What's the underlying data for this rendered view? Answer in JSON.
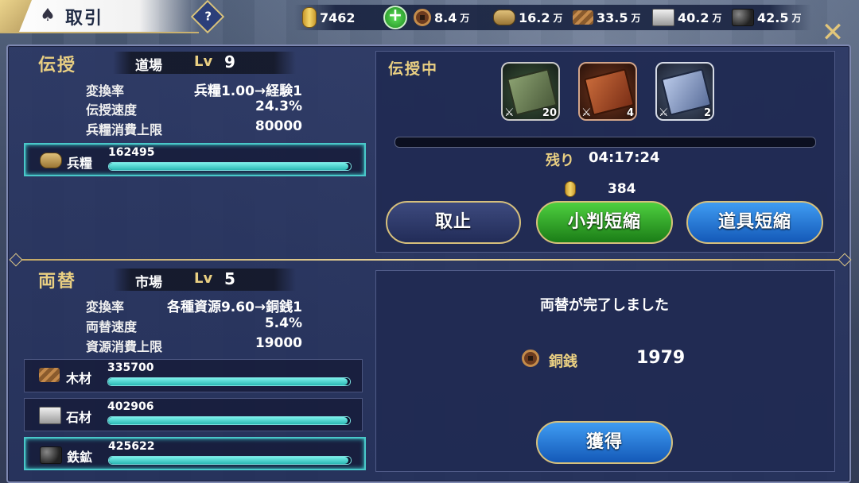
{
  "header": {
    "title": "取引",
    "help_label": "?",
    "close_label": "✕"
  },
  "resources": {
    "koban": "7462",
    "copper": "8.4",
    "copper_unit": "万",
    "rice": "16.2",
    "rice_unit": "万",
    "wood": "33.5",
    "wood_unit": "万",
    "stone": "40.2",
    "stone_unit": "万",
    "iron": "42.5",
    "iron_unit": "万"
  },
  "teaching": {
    "section_title": "伝授",
    "facility": "道場",
    "lv_label": "Lv",
    "level": "9",
    "stats": [
      {
        "label": "変換率",
        "value": "兵糧1.00→経験1"
      },
      {
        "label": "伝授速度",
        "value": "24.3%"
      },
      {
        "label": "兵糧消費上限",
        "value": "80000"
      }
    ],
    "resource": {
      "name": "兵糧",
      "value": "162495",
      "fill": 0.99
    },
    "status_label": "伝授中",
    "books": [
      {
        "icon": "green-book-icon",
        "count": "20"
      },
      {
        "icon": "red-book-icon",
        "count": "4"
      },
      {
        "icon": "blue-book-icon",
        "count": "2"
      }
    ],
    "progress": 0.0,
    "remain_label": "残り",
    "remain_time": "04:17:24",
    "cost": "384",
    "buttons": {
      "cancel": "取止",
      "koban_shorten": "小判短縮",
      "item_shorten": "道具短縮"
    }
  },
  "exchange": {
    "section_title": "両替",
    "facility": "市場",
    "lv_label": "Lv",
    "level": "5",
    "stats": [
      {
        "label": "変換率",
        "value": "各種資源9.60→銅銭1"
      },
      {
        "label": "両替速度",
        "value": "5.4%"
      },
      {
        "label": "資源消費上限",
        "value": "19000"
      }
    ],
    "resources": [
      {
        "name": "木材",
        "value": "335700",
        "fill": 0.99
      },
      {
        "name": "石材",
        "value": "402906",
        "fill": 0.99
      },
      {
        "name": "鉄鉱",
        "value": "425622",
        "fill": 0.99
      }
    ],
    "complete_message": "両替が完了しました",
    "result_name": "銅銭",
    "result_value": "1979",
    "obtain_button": "獲得"
  }
}
